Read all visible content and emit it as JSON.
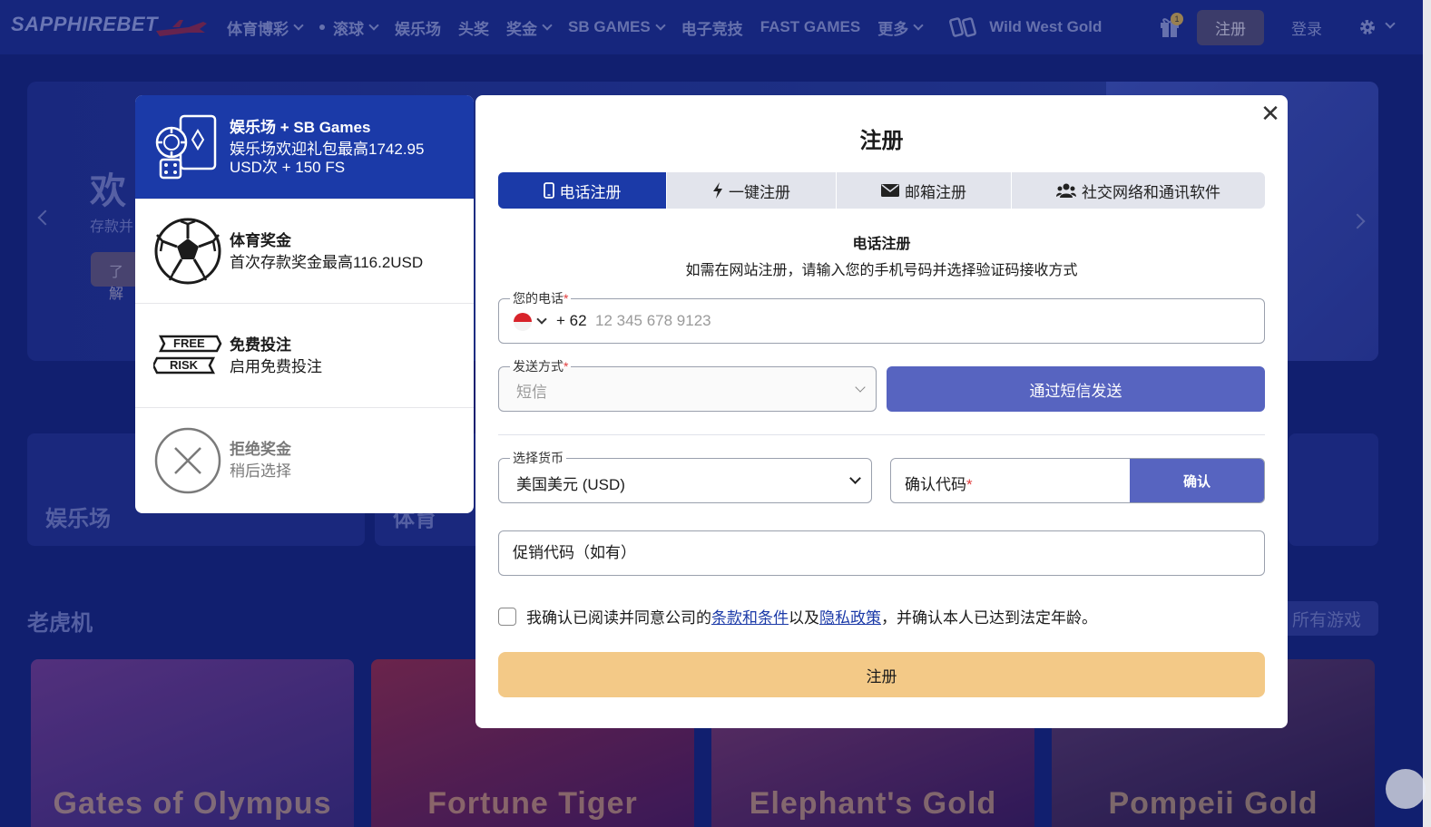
{
  "header": {
    "logo": "SAPPHIREBET",
    "nav": [
      {
        "label": "体育博彩",
        "dropdown": true,
        "dot": false
      },
      {
        "label": "滚球",
        "dropdown": true,
        "dot": true
      },
      {
        "label": "娱乐场",
        "dropdown": false,
        "dot": false
      },
      {
        "label": "头奖",
        "dropdown": false,
        "dot": false
      },
      {
        "label": "奖金",
        "dropdown": true,
        "dot": false
      },
      {
        "label": "SB GAMES",
        "dropdown": true,
        "dot": false
      },
      {
        "label": "电子竞技",
        "dropdown": false,
        "dot": false
      },
      {
        "label": "FAST GAMES",
        "dropdown": false,
        "dot": false
      },
      {
        "label": "更多",
        "dropdown": true,
        "dot": false
      }
    ],
    "promo_label": "Wild West Gold",
    "gift_badge": "1",
    "register_label": "注册",
    "login_label": "登录"
  },
  "background": {
    "hero_title": "欢",
    "hero_sub": "存款并",
    "hero_btn": "了解",
    "categories": [
      "娱乐场",
      "体育"
    ],
    "slots_title": "老虎机",
    "all_games": "所有游戏",
    "slots": [
      "Gates of Olympus",
      "Fortune Tiger",
      "Elephant's Gold",
      "Pompeii Gold"
    ]
  },
  "bonus_panel": {
    "items": [
      {
        "title": "娱乐场 + SB Games",
        "desc": "娱乐场欢迎礼包最高1742.95 USD次 + 150 FS",
        "icon": "casino-chips-icon",
        "active": true
      },
      {
        "title": "体育奖金",
        "desc": "首次存款奖金最高116.2USD",
        "icon": "soccer-ball-icon",
        "active": false
      },
      {
        "title": "免费投注",
        "desc": "启用免费投注",
        "icon": "free-risk-icon",
        "active": false
      },
      {
        "title": "拒绝奖金",
        "desc": "稍后选择",
        "icon": "decline-icon",
        "active": false
      }
    ],
    "free_tag": "FREE",
    "risk_tag": "RISK"
  },
  "modal": {
    "title": "注册",
    "tabs": [
      {
        "label": "电话注册",
        "icon": "phone-icon",
        "active": true
      },
      {
        "label": "一键注册",
        "icon": "lightning-icon",
        "active": false
      },
      {
        "label": "邮箱注册",
        "icon": "envelope-icon",
        "active": false
      },
      {
        "label": "社交网络和通讯软件",
        "icon": "users-icon",
        "active": false
      }
    ],
    "section_head": "电话注册",
    "section_desc": "如需在网站注册，请输入您的手机号码并选择验证码接收方式",
    "phone": {
      "label": "您的电话",
      "code": "+ 62",
      "placeholder": "12 345 678 9123",
      "value": ""
    },
    "method": {
      "label": "发送方式",
      "value": "短信"
    },
    "sms_button": "通过短信发送",
    "currency": {
      "label": "选择货币",
      "value": "美国美元 (USD)"
    },
    "confirm_code": {
      "label": "确认代码",
      "button": "确认"
    },
    "promo": {
      "placeholder": "促销代码（如有）",
      "value": ""
    },
    "terms": {
      "prefix": "我确认已阅读并同意公司的",
      "link1": "条款和条件",
      "mid": "以及",
      "link2": "隐私政策",
      "suffix": "，并确认本人已达到法定年龄。"
    },
    "submit": "注册"
  },
  "colors": {
    "primary": "#1b3aa8",
    "secondary": "#5764c0",
    "submit": "#f3c987",
    "background": "#13237a"
  }
}
